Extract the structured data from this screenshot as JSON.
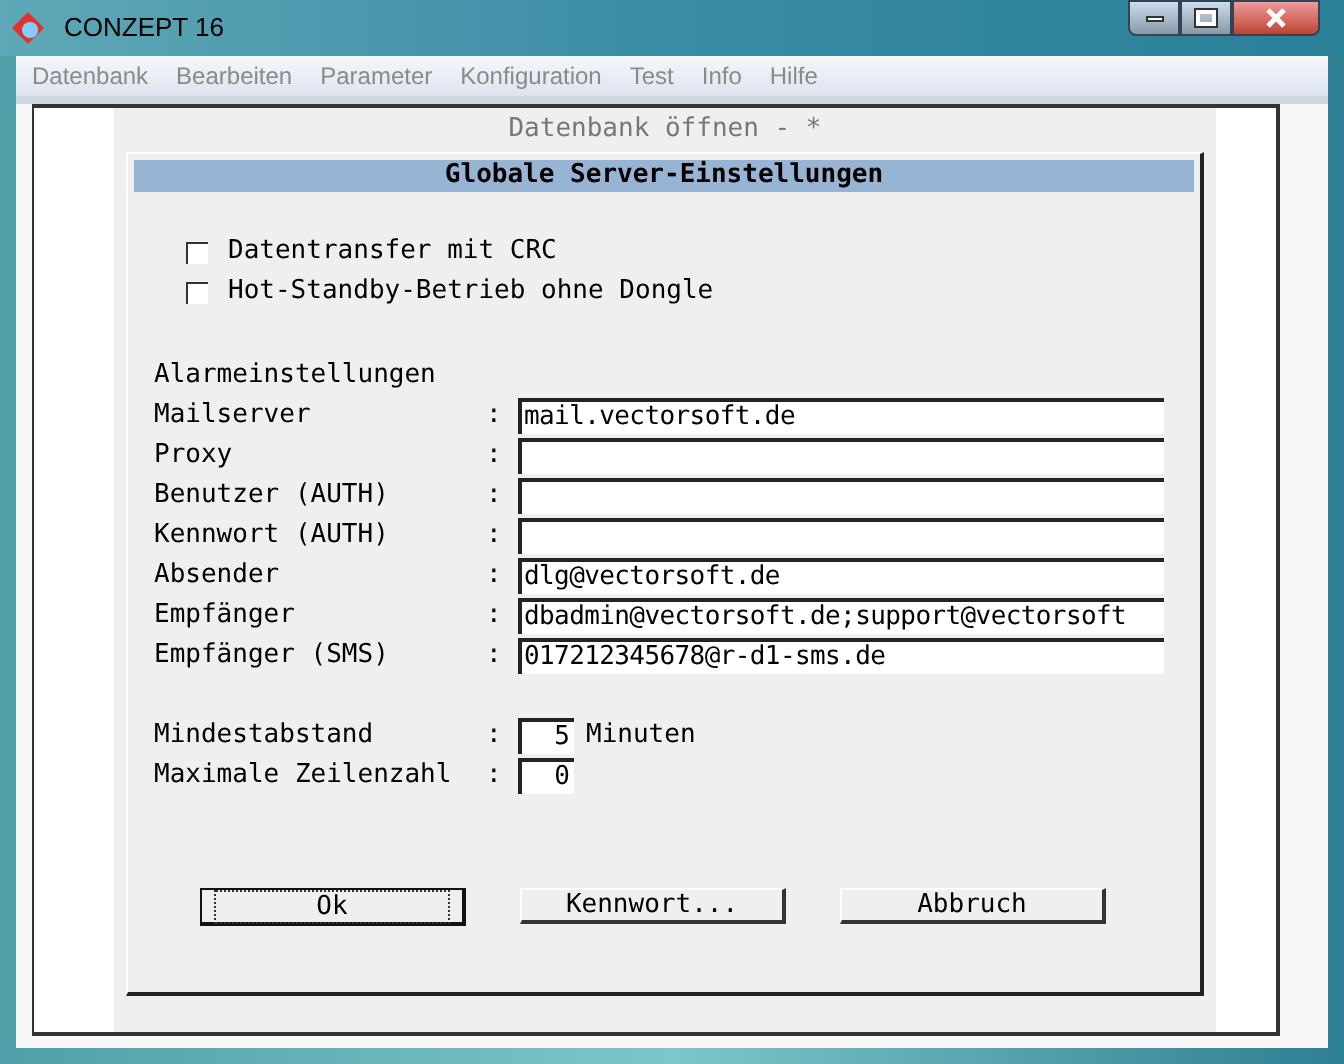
{
  "window": {
    "title": "CONZEPT 16"
  },
  "menu": [
    "Datenbank",
    "Bearbeiten",
    "Parameter",
    "Konfiguration",
    "Test",
    "Info",
    "Hilfe"
  ],
  "panel_title": "Datenbank öffnen - *",
  "dialog": {
    "title": "Globale Server-Einstellungen",
    "checkboxes": [
      {
        "label": "Datentransfer mit CRC",
        "checked": false
      },
      {
        "label": "Hot-Standby-Betrieb ohne Dongle",
        "checked": false
      }
    ],
    "section": "Alarmeinstellungen",
    "fields": [
      {
        "label": "Mailserver",
        "separator": ":",
        "value": "mail.vectorsoft.de"
      },
      {
        "label": "Proxy",
        "separator": ":"
      },
      {
        "label": "Benutzer (AUTH)",
        "separator": ":"
      },
      {
        "label": "Kennwort (AUTH)",
        "separator": ":"
      },
      {
        "label": "Absender",
        "separator": ":",
        "value": "dlg@vectorsoft.de"
      },
      {
        "label": "Empfänger",
        "separator": ":",
        "value": "dbadmin@vectorsoft.de;support@vectorsoft"
      },
      {
        "label": "Empfänger (SMS)",
        "separator": ":",
        "value": "017212345678@r-d1-sms.de"
      }
    ],
    "number_fields": [
      {
        "label": "Mindestabstand",
        "separator": ":",
        "value": "5",
        "unit": "Minuten"
      },
      {
        "label": "Maximale Zeilenzahl",
        "separator": ":",
        "value": "0"
      }
    ],
    "buttons": [
      {
        "label": "Ok",
        "default": true
      },
      {
        "label": "Kennwort...",
        "default": false
      },
      {
        "label": "Abbruch",
        "default": false
      }
    ]
  }
}
